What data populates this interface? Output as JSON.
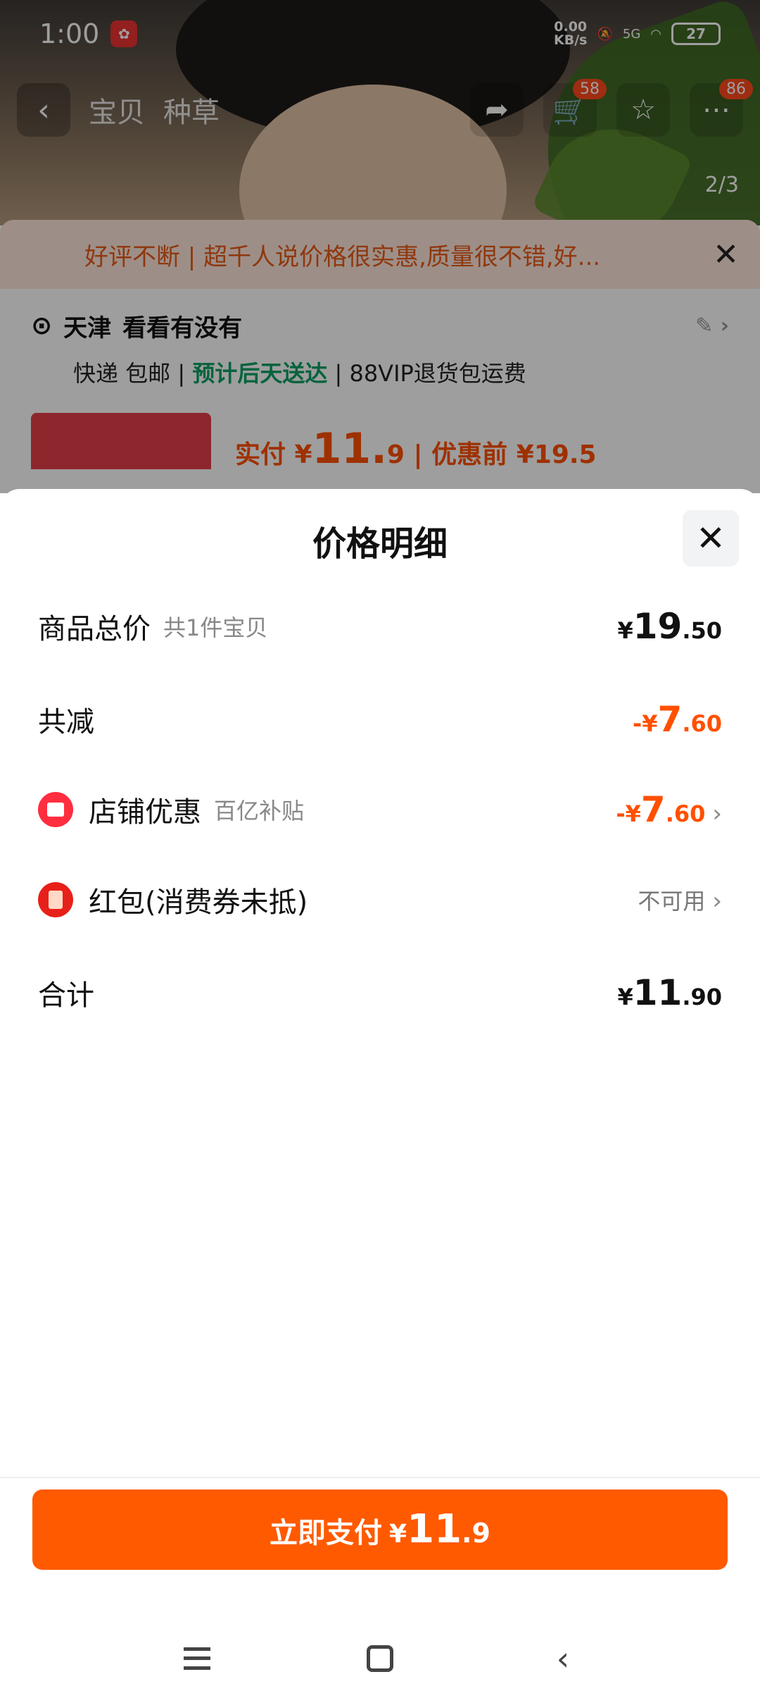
{
  "status_bar": {
    "time": "1:00",
    "network_speed_top": "0.00",
    "network_speed_bottom": "KB/s",
    "signal": "5G",
    "battery": "27"
  },
  "background": {
    "tabs": [
      "宝贝",
      "种草"
    ],
    "cart_badge": "58",
    "more_badge": "86",
    "image_counter": "2/3",
    "banner_text": "好评不断 | 超千人说价格很实惠,质量很不错,好...",
    "address_city": "天津",
    "address_name": "看看有没有",
    "delivery_prefix": "快递 包邮 |",
    "delivery_highlight": "预计后天送达",
    "delivery_suffix": "| 88VIP退货包运费",
    "price_prefix": "实付 ¥",
    "price_int": "11.",
    "price_dec": "9",
    "price_before": "| 优惠前 ¥19.5"
  },
  "sheet": {
    "title": "价格明细",
    "rows": {
      "total": {
        "label": "商品总价",
        "sub": "共1件宝贝",
        "currency": "¥",
        "int": "19",
        "dec": ".50"
      },
      "discount": {
        "label": "共减",
        "currency": "-¥",
        "int": "7",
        "dec": ".60"
      },
      "store": {
        "label": "店铺优惠",
        "sub": "百亿补贴",
        "currency": "-¥",
        "int": "7",
        "dec": ".60"
      },
      "redpacket": {
        "label": "红包(消费券未抵)",
        "value": "不可用"
      },
      "sum": {
        "label": "合计",
        "currency": "¥",
        "int": "11",
        "dec": ".90"
      }
    }
  },
  "pay_button": {
    "label": "立即支付",
    "currency": "¥",
    "int": "11",
    "dec": ".9"
  },
  "colors": {
    "accent": "#ff5a00",
    "discount": "#ff5000",
    "green": "#0aa162"
  }
}
